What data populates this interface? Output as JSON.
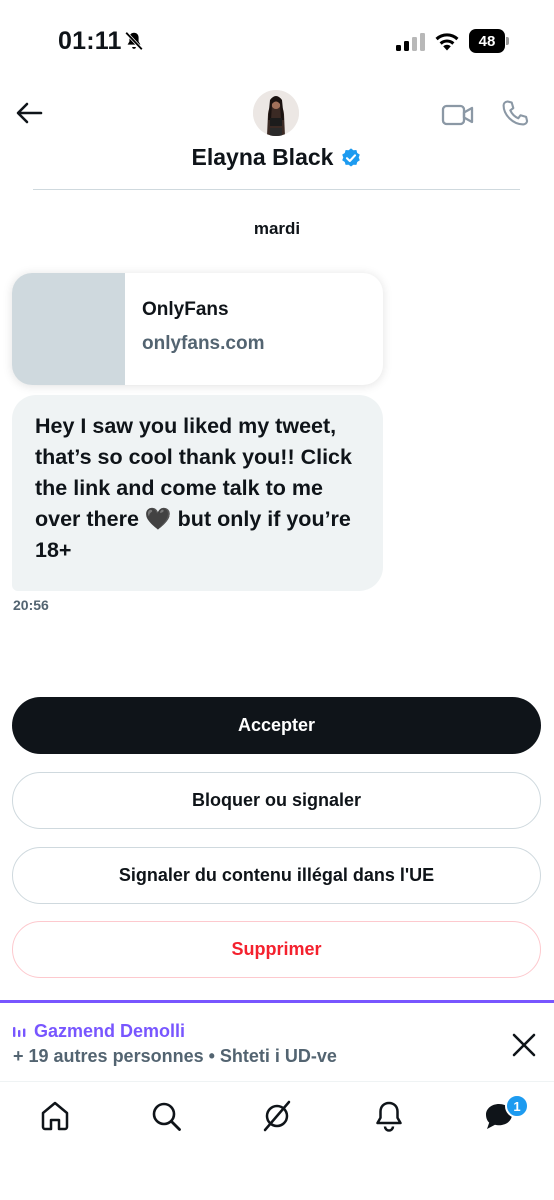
{
  "status_bar": {
    "time": "01:11",
    "battery_level": "48",
    "icons": [
      "bell-off-icon",
      "signal-icon",
      "wifi-icon",
      "battery-icon"
    ]
  },
  "header": {
    "contact_name": "Elayna Black",
    "verified": true,
    "icons": [
      "back-arrow-icon",
      "video-call-icon",
      "phone-icon",
      "verified-badge-icon"
    ]
  },
  "conversation": {
    "date_label": "mardi",
    "link_card": {
      "title": "OnlyFans",
      "domain": "onlyfans.com"
    },
    "message": {
      "text": "Hey I saw you liked my tweet, that’s so cool thank you!! Click the link and come talk to me over there 🖤 but only if you’re 18+",
      "time": "20:56"
    }
  },
  "actions": {
    "accept": "Accepter",
    "block_report": "Bloquer ou signaler",
    "report_illegal": "Signaler du contenu illégal dans l'UE",
    "delete": "Supprimer"
  },
  "spaces_bar": {
    "host": "Gazmend Demolli",
    "subtitle": "+ 19 autres personnes • Shteti i UD-ve"
  },
  "bottom_nav": {
    "items": [
      "home-icon",
      "search-icon",
      "grok-icon",
      "notifications-icon",
      "messages-icon"
    ],
    "messages_badge": "1"
  },
  "colors": {
    "accent_blue": "#1d9bf0",
    "spaces_purple": "#7856ff",
    "delete_red": "#f4212e",
    "bubble_gray": "#eff3f4"
  }
}
